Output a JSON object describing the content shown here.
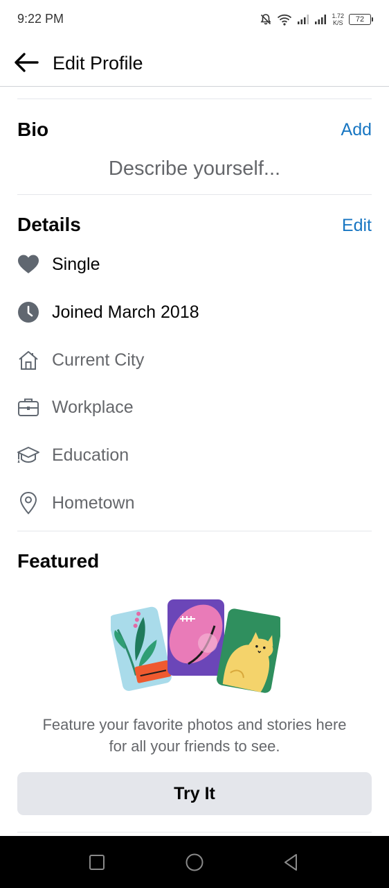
{
  "status_bar": {
    "time": "9:22 PM",
    "net_speed_value": "1.72",
    "net_speed_unit": "K/S",
    "battery": "72",
    "icons": [
      "bell-off-icon",
      "wifi-icon",
      "signal-icon",
      "signal-icon"
    ]
  },
  "header": {
    "title": "Edit Profile",
    "back_icon": "arrow-left-icon"
  },
  "bio": {
    "title": "Bio",
    "action": "Add",
    "placeholder": "Describe yourself..."
  },
  "details": {
    "title": "Details",
    "action": "Edit",
    "items": [
      {
        "icon": "heart-icon",
        "label": "Single",
        "filled": true
      },
      {
        "icon": "clock-icon",
        "label": "Joined March 2018",
        "filled": true
      },
      {
        "icon": "house-icon",
        "label": "Current City",
        "filled": false
      },
      {
        "icon": "briefcase-icon",
        "label": "Workplace",
        "filled": false
      },
      {
        "icon": "graduation-cap-icon",
        "label": "Education",
        "filled": false
      },
      {
        "icon": "location-pin-icon",
        "label": "Hometown",
        "filled": false
      }
    ]
  },
  "featured": {
    "title": "Featured",
    "description_line1": "Feature your favorite photos and stories here",
    "description_line2": "for all your friends to see.",
    "button": "Try It"
  },
  "nav_bar": {
    "icons": [
      "recent-apps-icon",
      "home-icon",
      "back-icon"
    ]
  },
  "colors": {
    "accent": "#1876c2",
    "text_primary": "#050505",
    "text_secondary": "#65676b",
    "button_bg": "#e4e6eb"
  }
}
